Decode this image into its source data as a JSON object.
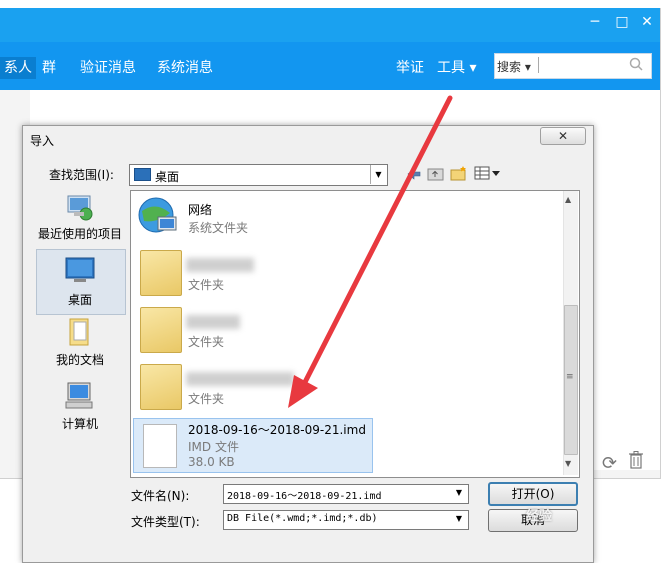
{
  "background_window": {
    "nav": {
      "contacts_partial": "系人",
      "groups": "群",
      "verify_messages": "验证消息",
      "system_messages": "系统消息",
      "report": "举证",
      "tools": "工具 ▾"
    },
    "search": {
      "scope_label": "搜索 ▾",
      "icon": "search-icon"
    },
    "window_controls": [
      "─",
      "□",
      "✕"
    ],
    "footer_icons": [
      "refresh-icon",
      "trash-icon"
    ]
  },
  "dialog": {
    "title": "导入",
    "close_glyph": "✕",
    "look_in": {
      "label": "查找范围(I):",
      "value": "桌面"
    },
    "toolbar_icons": [
      "back-icon",
      "up-folder-icon",
      "new-folder-icon",
      "view-menu-icon"
    ],
    "places": [
      {
        "label": "最近使用的项目",
        "icon": "recent-items-icon"
      },
      {
        "label": "桌面",
        "icon": "desktop-icon",
        "selected": true
      },
      {
        "label": "我的文档",
        "icon": "documents-icon"
      },
      {
        "label": "计算机",
        "icon": "computer-icon"
      }
    ],
    "files": [
      {
        "name": "网络",
        "type": "系统文件夹",
        "icon": "network-icon"
      },
      {
        "name": "",
        "type": "文件夹",
        "icon": "folder-icon",
        "name_blurred": true
      },
      {
        "name": "",
        "type": "文件夹",
        "icon": "folder-icon",
        "name_blurred": true
      },
      {
        "name": "",
        "type": "文件夹",
        "icon": "folder-icon",
        "name_blurred": true
      },
      {
        "name": "2018-09-16～2018-09-21.imd",
        "type": "IMD 文件",
        "size": "38.0 KB",
        "icon": "document-icon",
        "selected": true
      }
    ],
    "file_name": {
      "label": "文件名(N):",
      "value": "2018-09-16～2018-09-21.imd"
    },
    "file_type": {
      "label": "文件类型(T):",
      "value": "DB File(*.wmd;*.imd;*.db)"
    },
    "open_button": "打开(O)",
    "cancel_button": "取消"
  },
  "annotation": {
    "arrow_color": "#e8393f"
  },
  "watermark": "经验",
  "colors": {
    "titlebar": "#1aa1f0",
    "nav": "#1296f0",
    "selection": "#dbeaf9"
  }
}
